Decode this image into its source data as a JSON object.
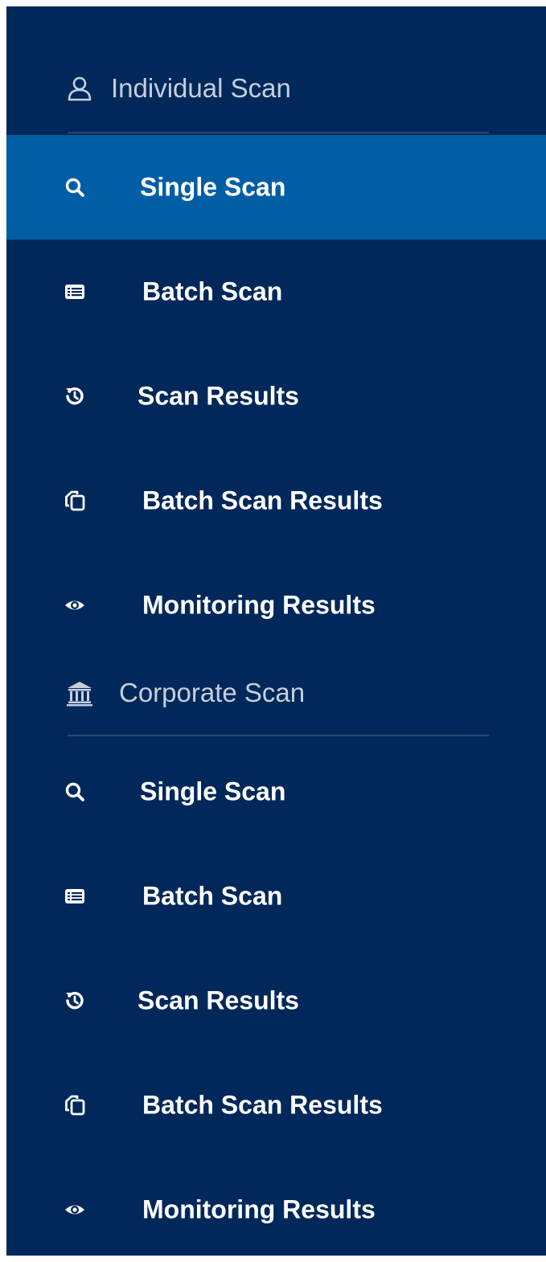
{
  "sidebar": {
    "sections": [
      {
        "title": "Individual Scan",
        "icon": "user-outline-icon",
        "items": [
          {
            "label": "Single Scan",
            "icon": "search-icon",
            "active": true
          },
          {
            "label": "Batch Scan",
            "icon": "list-card-icon",
            "active": false
          },
          {
            "label": "Scan Results",
            "icon": "history-icon",
            "active": false
          },
          {
            "label": "Batch Scan Results",
            "icon": "copy-icon",
            "active": false
          },
          {
            "label": "Monitoring Results",
            "icon": "eye-icon",
            "active": false
          }
        ]
      },
      {
        "title": "Corporate Scan",
        "icon": "bank-icon",
        "items": [
          {
            "label": "Single Scan",
            "icon": "search-icon",
            "active": false
          },
          {
            "label": "Batch Scan",
            "icon": "list-card-icon",
            "active": false
          },
          {
            "label": "Scan Results",
            "icon": "history-icon",
            "active": false
          },
          {
            "label": "Batch Scan Results",
            "icon": "copy-icon",
            "active": false
          },
          {
            "label": "Monitoring Results",
            "icon": "eye-icon",
            "active": false
          }
        ]
      }
    ]
  },
  "colors": {
    "sidebar_bg": "#01285a",
    "active_bg": "#025ea4",
    "section_text": "#c6cfdc",
    "item_text": "#ffffff"
  }
}
